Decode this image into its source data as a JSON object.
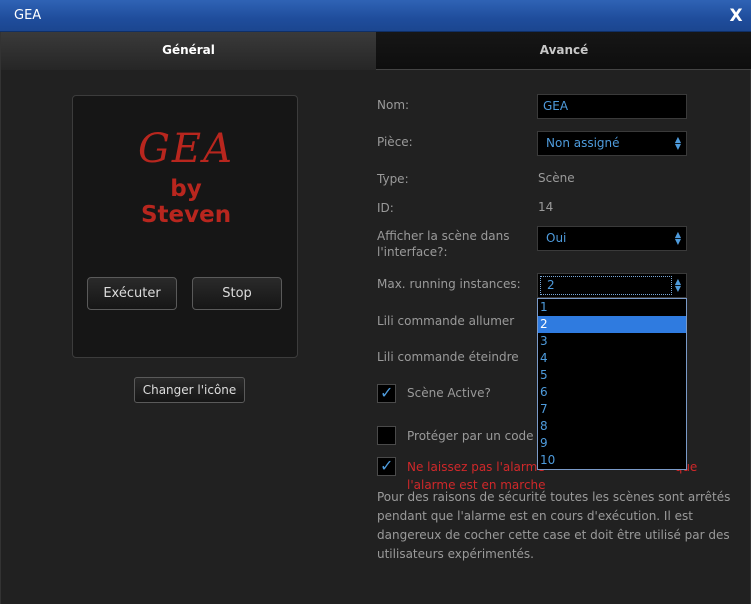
{
  "window": {
    "title": "GEA",
    "close_glyph": "X"
  },
  "tabs": [
    {
      "label": "Général",
      "active": true
    },
    {
      "label": "Avancé",
      "active": false
    }
  ],
  "scene_icon": {
    "logo_text": "GEA",
    "by": "by",
    "author": "Steven"
  },
  "buttons": {
    "execute": "Exécuter",
    "stop": "Stop",
    "change_icon": "Changer l'icône"
  },
  "form": {
    "name_label": "Nom:",
    "name_value": "GEA",
    "room_label": "Pièce:",
    "room_value": "Non assigné",
    "type_label": "Type:",
    "type_value": "Scène",
    "id_label": "ID:",
    "id_value": "14",
    "show_label_line1": "Afficher la scène dans",
    "show_label_line2": "l'interface?:",
    "show_value": "Oui",
    "max_label": "Max. running instances:",
    "max_value": "2",
    "max_options": [
      "1",
      "2",
      "3",
      "4",
      "5",
      "6",
      "7",
      "8",
      "9",
      "10"
    ],
    "max_selected_index": 1,
    "lili_on_label": "Lili commande allumer",
    "lili_off_label": "Lili commande éteindre"
  },
  "checkboxes": {
    "active_label": "Scène Active?",
    "active_checked": true,
    "protect_label": "Protéger par un code P",
    "protect_checked": false,
    "alarm_label_line1_left": "Ne laissez pas l'alarme",
    "alarm_label_line1_right": "que",
    "alarm_label_line2": "l'alarme est en marche",
    "alarm_checked": true
  },
  "info_text": "Pour des raisons de sécurité toutes les scènes sont arrêtés pendant que l'alarme est en cours d'exécution. Il est dangereux de cocher cette case et doit être utilisé par des utilisateurs expérimentés.",
  "colors": {
    "title_bar": "#2358a8",
    "accent": "#4e9bdc",
    "logo_red": "#b8261e",
    "warning_red": "#d0282a",
    "selection": "#2f7be0"
  }
}
